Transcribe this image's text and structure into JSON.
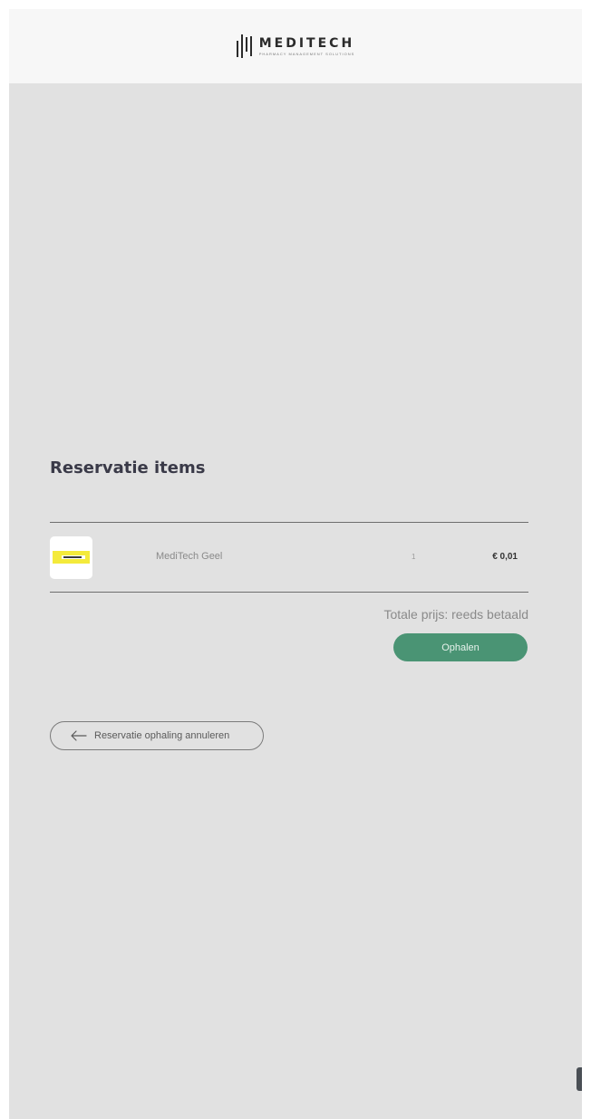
{
  "header": {
    "logo_word": "MEDITECH",
    "logo_tagline": "PHARMACY MANAGEMENT SOLUTIONS"
  },
  "reservation": {
    "title": "Reservatie items",
    "items": [
      {
        "thumbnail": "meditech-card-image",
        "name": "MediTech Geel",
        "quantity": "1",
        "price": "€ 0,01"
      }
    ],
    "total_text": "Totale prijs: reeds betaald",
    "pickup_label": "Ophalen",
    "cancel_label": "Reservatie ophaling annuleren",
    "cancel_icon": "arrow-left-icon"
  },
  "colors": {
    "background": "#e1e1e1",
    "header": "#f7f7f7",
    "primary_button": "#4a9474",
    "title_text": "#3a3a48",
    "card_yellow": "#f4ea3b"
  }
}
